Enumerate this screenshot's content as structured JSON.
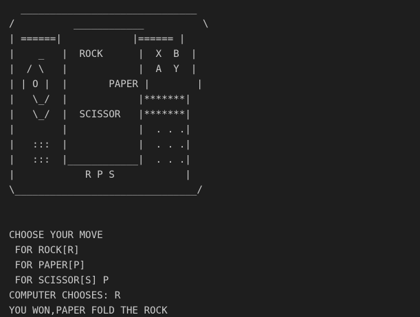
{
  "theme": {
    "background": "#1e1e1e",
    "foreground": "#cccccc"
  },
  "terminal": {
    "lines": [
      "  ______________________________",
      "/          ____________          \\",
      "| ======|            |====== |",
      "|    _   |  ROCK      |  X  B  |",
      "|  / \\   |            |  A  Y  |",
      "| | O |  |       PAPER |        |",
      "|   \\_/  |            |*******|",
      "|   \\_/  |  SCISSOR   |*******|",
      "|        |            |  . . .|",
      "|   :::  |            |  . . .|",
      "|   :::  |____________|  . . .|",
      "|            R P S            |",
      "\\_______________________________/",
      "",
      "",
      "CHOOSE YOUR MOVE",
      " FOR ROCK[R]",
      " FOR PAPER[P]",
      " FOR SCISSOR[S] P",
      "COMPUTER CHOOSES: R",
      "YOU WON,PAPER FOLD THE ROCK"
    ]
  }
}
